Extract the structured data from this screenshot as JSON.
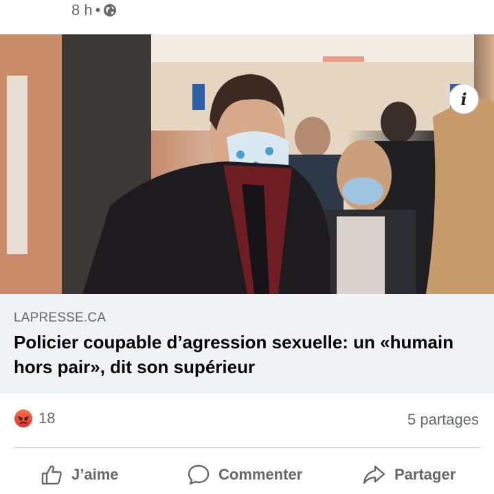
{
  "post": {
    "time": "8 h",
    "separator": "•",
    "privacy_icon": "globe-icon"
  },
  "photo": {
    "info_label": "i"
  },
  "link": {
    "domain": "LAPRESSE.CA",
    "headline": "Policier coupable d’agression sexuelle: un «humain hors pair», dit son supérieur"
  },
  "stats": {
    "reaction_icon": "angry-icon",
    "reaction_count": "18",
    "shares": "5 partages"
  },
  "actions": {
    "like": "J’aime",
    "comment": "Commenter",
    "share": "Partager"
  },
  "colors": {
    "secondary_text": "#65676b",
    "link_box_bg": "#f0f2f5",
    "angry_top": "#f7714c",
    "angry_bottom": "#e0322b"
  }
}
